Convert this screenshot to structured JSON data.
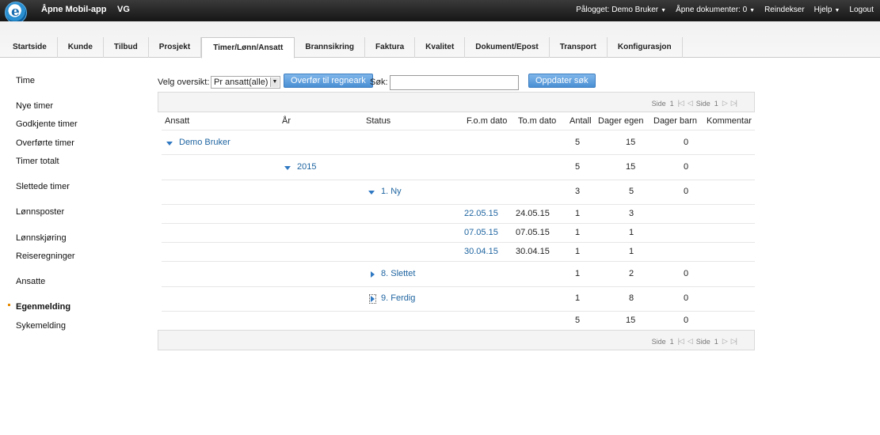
{
  "topbar": {
    "app_title": "Åpne Mobil-app",
    "app_sub": "VG",
    "logged_in": "Pålogget: Demo Bruker",
    "open_docs": "Åpne dokumenter: 0",
    "reindex": "Reindekser",
    "help": "Hjelp",
    "logout": "Logout"
  },
  "tabs": [
    "Startside",
    "Kunde",
    "Tilbud",
    "Prosjekt",
    "Timer/Lønn/Ansatt",
    "Brannsikring",
    "Faktura",
    "Kvalitet",
    "Dokument/Epost",
    "Transport",
    "Konfigurasjon"
  ],
  "active_tab": "Timer/Lønn/Ansatt",
  "sidebar": [
    "Time",
    "Nye timer",
    "Godkjente timer",
    "Overførte timer",
    "Timer totalt",
    "Slettede timer",
    "Lønnsposter",
    "Lønnskjøring",
    "Reiseregninger",
    "Ansatte",
    "Egenmelding",
    "Sykemelding"
  ],
  "sidebar_active": "Egenmelding",
  "toolbar": {
    "overview_label": "Velg oversikt:",
    "overview_value": "Pr ansatt(alle)",
    "transfer_button": "Overfør til regneark",
    "search_label": "Søk:",
    "search_value": "",
    "update_button": "Oppdater søk"
  },
  "pager": {
    "side_label": "Side",
    "page": "1",
    "total": "1"
  },
  "columns": [
    "Ansatt",
    "År",
    "Status",
    "F.o.m dato",
    "To.m dato",
    "Antall",
    "Dager egen",
    "Dager barn",
    "Kommentar"
  ],
  "groups": {
    "employee": {
      "name": "Demo Bruker",
      "antall": "5",
      "dager_egen": "15",
      "dager_barn": "0"
    },
    "year": {
      "name": "2015",
      "antall": "5",
      "dager_egen": "15",
      "dager_barn": "0"
    },
    "status_ny": {
      "name": "1. Ny",
      "antall": "3",
      "dager_egen": "5",
      "dager_barn": "0"
    },
    "status_slettet": {
      "name": "8. Slettet",
      "antall": "1",
      "dager_egen": "2",
      "dager_barn": "0"
    },
    "status_ferdig": {
      "name": "9. Ferdig",
      "antall": "1",
      "dager_egen": "8",
      "dager_barn": "0"
    }
  },
  "detail_rows": [
    {
      "fom": "22.05.15",
      "tom": "24.05.15",
      "antall": "1",
      "dager_egen": "3"
    },
    {
      "fom": "07.05.15",
      "tom": "07.05.15",
      "antall": "1",
      "dager_egen": "1"
    },
    {
      "fom": "30.04.15",
      "tom": "30.04.15",
      "antall": "1",
      "dager_egen": "1"
    }
  ],
  "totals": {
    "antall": "5",
    "dager_egen": "15",
    "dager_barn": "0"
  }
}
